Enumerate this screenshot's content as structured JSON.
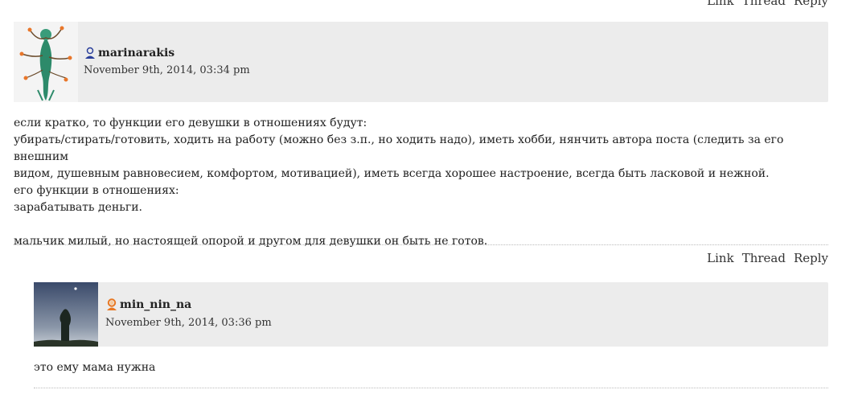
{
  "top_actions": {
    "link": "Link",
    "thread": "Thread",
    "reply": "Reply"
  },
  "comments": [
    {
      "username": "marinarakis",
      "date": "November 9th, 2014, 03:34 pm",
      "body": "если кратко, то функции его девушки в отношениях будут:\nубирать/стирать/готовить, ходить на работу (можно без з.п., но ходить надо), иметь хобби, нянчить автора поста (следить за его внешним\nвидом, душевным равновесием, комфортом, мотивацией), иметь всегда хорошее настроение, всегда быть ласковой и нежной.\nего функции в отношениях:\nзарабатывать деньги.\n\nмальчик милый, но настоящей опорой и другом для девушки он быть не готов.",
      "actions": {
        "link": "Link",
        "thread": "Thread",
        "reply": "Reply"
      }
    },
    {
      "username": "min_nin_na",
      "date": "November 9th, 2014, 03:36 pm",
      "body": "это ему мама нужна"
    }
  ],
  "colors": {
    "header_bg": "#ececec",
    "user_icon_male": "#2a3f9a",
    "user_icon_female": "#e87722"
  }
}
